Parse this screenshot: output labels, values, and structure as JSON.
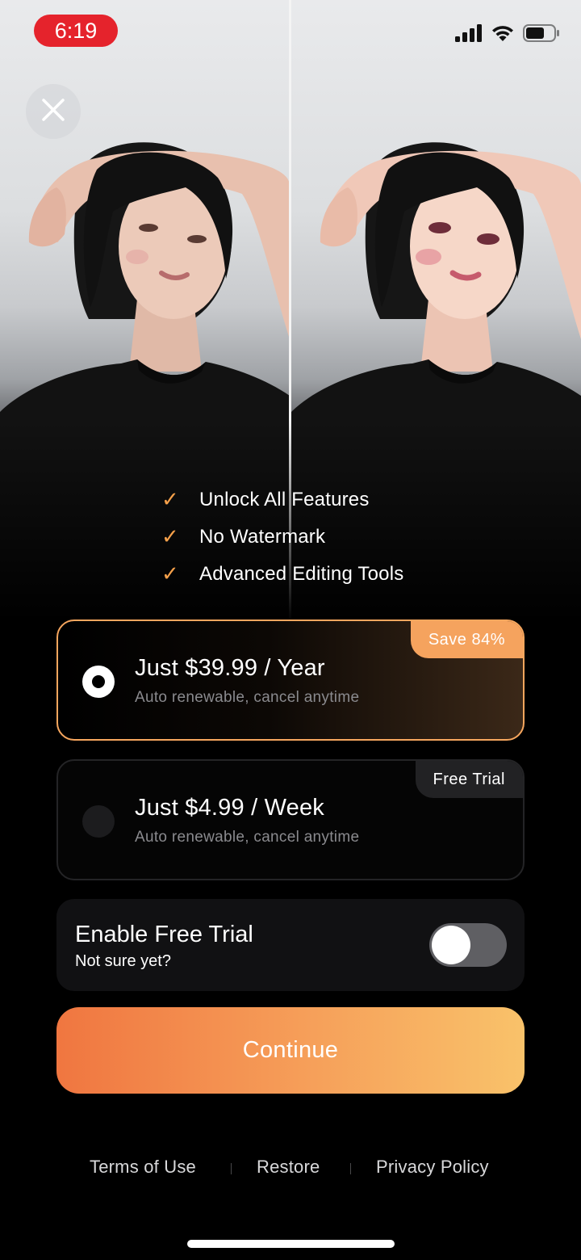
{
  "status_bar": {
    "time": "6:19",
    "time_pill_color": "#e5232c",
    "icons": [
      "cellular-signal-icon",
      "wifi-icon",
      "battery-icon"
    ],
    "battery_level": 0.6
  },
  "hero": {
    "image_left": "before-photo",
    "image_right": "after-photo"
  },
  "close_icon": "close-icon",
  "features": [
    {
      "icon": "checkmark-icon",
      "label": "Unlock All Features"
    },
    {
      "icon": "checkmark-icon",
      "label": "No Watermark"
    },
    {
      "icon": "checkmark-icon",
      "label": "Advanced Editing Tools"
    }
  ],
  "plans": [
    {
      "title": "Just $39.99 / Year",
      "subtitle": "Auto renewable, cancel anytime",
      "badge": "Save 84%",
      "selected": true
    },
    {
      "title": "Just $4.99 / Week",
      "subtitle": "Auto renewable, cancel anytime",
      "badge": "Free Trial",
      "selected": false
    }
  ],
  "trial": {
    "title": "Enable Free Trial",
    "subtitle": "Not sure yet?",
    "enabled": false
  },
  "continue_label": "Continue",
  "footer": {
    "terms": "Terms of Use",
    "restore": "Restore",
    "privacy": "Privacy Policy"
  },
  "colors": {
    "accent": "#f5a35e",
    "checkmark": "#f5a04a",
    "continue_start": "#f07640",
    "continue_end": "#f9c26a",
    "background": "#000000"
  }
}
